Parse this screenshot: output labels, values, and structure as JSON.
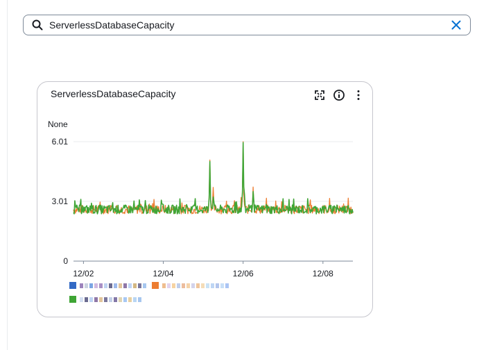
{
  "search": {
    "value": "ServerlessDatabaseCapacity",
    "placeholder": "Search"
  },
  "widget": {
    "title": "ServerlessDatabaseCapacity",
    "unit_label": "None",
    "actions": [
      "fullscreen-icon",
      "info-icon",
      "more-options-icon"
    ]
  },
  "chart_data": {
    "type": "line",
    "title": "ServerlessDatabaseCapacity",
    "ylabel": "None",
    "ylim": [
      0,
      6.01
    ],
    "yticks": [
      "0",
      "3.01",
      "6.01"
    ],
    "xlim": [
      "12/01 18:00",
      "12/08 18:00"
    ],
    "xticks": [
      "12/02",
      "12/04",
      "12/06",
      "12/08"
    ],
    "grid": true,
    "legend_position": "bottom",
    "series": [
      {
        "color": "#ed7d31",
        "approx_values": [
          {
            "x": "12/01 18:00",
            "y": 2.6
          },
          {
            "x": "12/03 01:00",
            "y": 2.7
          },
          {
            "x": "12/04 00:00",
            "y": 2.7
          },
          {
            "x": "12/05 04:00",
            "y": 5.3
          },
          {
            "x": "12/05 06:00",
            "y": 3.5
          },
          {
            "x": "12/06 00:00",
            "y": 6.0
          },
          {
            "x": "12/06 06:00",
            "y": 3.8
          },
          {
            "x": "12/08 18:00",
            "y": 2.7
          }
        ]
      },
      {
        "color": "#3fa535",
        "approx_values": [
          {
            "x": "12/01 18:00",
            "y": 2.6
          },
          {
            "x": "12/03 01:00",
            "y": 2.9
          },
          {
            "x": "12/03 23:00",
            "y": 3.6
          },
          {
            "x": "12/05 04:00",
            "y": 5.2
          },
          {
            "x": "12/05 06:00",
            "y": 3.4
          },
          {
            "x": "12/06 00:00",
            "y": 6.0
          },
          {
            "x": "12/06 06:00",
            "y": 3.7
          },
          {
            "x": "12/08 18:00",
            "y": 2.7
          }
        ]
      }
    ],
    "colors": {
      "orange": "#ed7d31",
      "green": "#3fa535",
      "blue": "#3369c4"
    }
  }
}
